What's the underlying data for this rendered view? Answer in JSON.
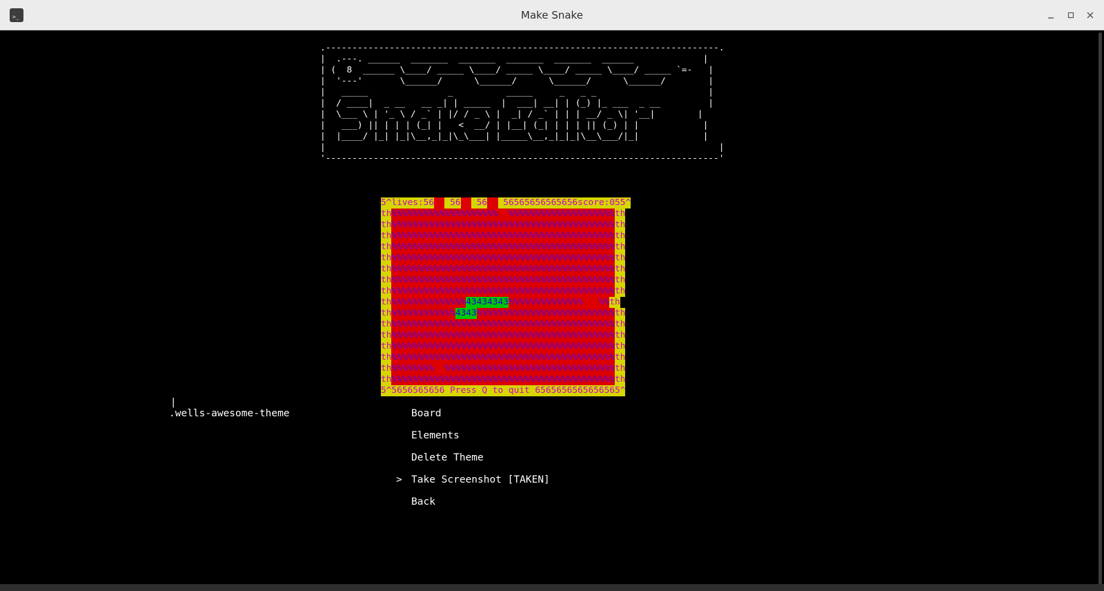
{
  "window": {
    "title": "Make Snake",
    "app_icon": "terminal-icon",
    "controls": [
      "minimize-icon",
      "maximize-icon",
      "close-icon"
    ]
  },
  "banner": {
    "ascii_art": ".--------------------------------------------------------------------------.\n|  .---. ______  _______  _______  _______  _______  ______             |\n| (  8  ______ \\____/ _____ \\____/ _____ \\____/ _____ \\____/ _____ `=-   |\n|  '---'       \\______/      \\______/      \\______/      \\______/        |\n|   _____               _          _____     _   _ _                     |\n|  / ____|  _ __   __ _| | _____  |  ___| __| | (_) |_ ___  _ __         |\n|  \\___ \\ | '_ \\ / _` | |/ / _ \\ |  _| / _` | | | __/ _ \\| '__|        |\n|   ___) || | | | (_| |   <  __/ | |__| (_| | | | || (_) | |            |\n|  |____/ |_| |_|\\__,_|_|\\_\\___| |_____\\__,_|_|_|\\__\\___/|_|            |\n|                                                                          |\n'--------------------------------------------------------------------------'"
  },
  "board": {
    "colors": {
      "border_bg": "#d6d600",
      "border_fg": "#cc00cc",
      "field_bg": "#dd0000",
      "field_fg": "#5a00e0",
      "snake_bg": "#00c800",
      "snake_fg": "#1a00dd"
    },
    "rows": [
      [
        {
          "c": "y",
          "t": "5^lives:56"
        },
        {
          "c": "r",
          "t": "  "
        },
        {
          "c": "y",
          "t": " 56"
        },
        {
          "c": "r",
          "t": "  "
        },
        {
          "c": "y",
          "t": " 56"
        },
        {
          "c": "r",
          "t": "  "
        },
        {
          "c": "y",
          "t": " 56565656565656score:055^"
        }
      ],
      [
        {
          "c": "y",
          "t": "th"
        },
        {
          "c": "r",
          "t": "%%%%%%%%%%%%%%%%%%%%  %%%%%%%%%%%%%%%%%%%%"
        },
        {
          "c": "y",
          "t": "th"
        }
      ],
      [
        {
          "c": "y",
          "t": "th"
        },
        {
          "c": "r",
          "t": "%%%%%%%%%%%%%%%%%%%%%%%%%%%%%%%%%%%%%%%%%%"
        },
        {
          "c": "y",
          "t": "th"
        }
      ],
      [
        {
          "c": "y",
          "t": "th"
        },
        {
          "c": "r",
          "t": "%%%%%%%%%%%%%%%%%%%%%%%%%%%%%%%%%%%%%%%%%%"
        },
        {
          "c": "y",
          "t": "th"
        }
      ],
      [
        {
          "c": "y",
          "t": "th"
        },
        {
          "c": "r",
          "t": "%%%%%%%%%%%%%%%%%%%%%%%%%%%%%%%%%%%%%%%%%%"
        },
        {
          "c": "y",
          "t": "th"
        }
      ],
      [
        {
          "c": "y",
          "t": "th"
        },
        {
          "c": "r",
          "t": "%%%%%%%%%%%%%%%%%%%%%%%%%%%%%%%%%%%%%%%%%%"
        },
        {
          "c": "y",
          "t": "th"
        }
      ],
      [
        {
          "c": "y",
          "t": "th"
        },
        {
          "c": "r",
          "t": "%%%%%%%%%%%%%%%%%%%%%%%%%%%%%%%%%%%%%%%%%%"
        },
        {
          "c": "y",
          "t": "th"
        }
      ],
      [
        {
          "c": "y",
          "t": "th"
        },
        {
          "c": "r",
          "t": "%%%%%%%%%%%%%%%%%%%%%%%%%%%%%%%%%%%%%%%%%%"
        },
        {
          "c": "y",
          "t": "th"
        }
      ],
      [
        {
          "c": "y",
          "t": "th"
        },
        {
          "c": "r",
          "t": "%%%%%%%%%%%%%%%%%%%%%%%%%%%%%%%%%%%%%%%%%%"
        },
        {
          "c": "y",
          "t": "th"
        }
      ],
      [
        {
          "c": "y",
          "t": "th"
        },
        {
          "c": "r",
          "t": "%%%%%%%%%%%%%%"
        },
        {
          "c": "g",
          "t": "43434343"
        },
        {
          "c": "r",
          "t": "%%%%%%%%%%%%%%   %%"
        },
        {
          "c": "y",
          "t": "th"
        }
      ],
      [
        {
          "c": "y",
          "t": "th"
        },
        {
          "c": "r",
          "t": "%%%%%%%%%%%%"
        },
        {
          "c": "g",
          "t": "4343"
        },
        {
          "c": "r",
          "t": "%%%%%%%%%%%%%%%%%%%%%%%%%%"
        },
        {
          "c": "y",
          "t": "th"
        }
      ],
      [
        {
          "c": "y",
          "t": "th"
        },
        {
          "c": "r",
          "t": "%%%%%%%%%%%%%%%%%%%%%%%%%%%%%%%%%%%%%%%%%%"
        },
        {
          "c": "y",
          "t": "th"
        }
      ],
      [
        {
          "c": "y",
          "t": "th"
        },
        {
          "c": "r",
          "t": "%%%%%%%%%%%%%%%%%%%%%%%%%%%%%%%%%%%%%%%%%%"
        },
        {
          "c": "y",
          "t": "th"
        }
      ],
      [
        {
          "c": "y",
          "t": "th"
        },
        {
          "c": "r",
          "t": "%%%%%%%%%%%%%%%%%%%%%%%%%%%%%%%%%%%%%%%%%%"
        },
        {
          "c": "y",
          "t": "th"
        }
      ],
      [
        {
          "c": "y",
          "t": "th"
        },
        {
          "c": "r",
          "t": "%%%%%%%%%%%%%%%%%%%%%%%%%%%%%%%%%%%%%%%%%%"
        },
        {
          "c": "y",
          "t": "th"
        }
      ],
      [
        {
          "c": "y",
          "t": "th"
        },
        {
          "c": "r",
          "t": "%%%%%%%%  %%%%%%%%%%%%%%%%%%%%%%%%%%%%%%%%"
        },
        {
          "c": "y",
          "t": "th"
        }
      ],
      [
        {
          "c": "y",
          "t": "th"
        },
        {
          "c": "r",
          "t": "%%%%%%%%%%%%%%%%%%%%%%%%%%%%%%%%%%%%%%%%%%"
        },
        {
          "c": "y",
          "t": "th"
        }
      ],
      [
        {
          "c": "y",
          "t": "5^5656565656 Press Q to quit 6565656565656565^"
        }
      ]
    ]
  },
  "theme": {
    "cursor": "|",
    "name": ".wells-awesome-theme"
  },
  "menu": {
    "selector": ">",
    "selected_index": 3,
    "items": [
      {
        "label": "Board"
      },
      {
        "label": "Elements"
      },
      {
        "label": "Delete Theme"
      },
      {
        "label": "Take Screenshot [TAKEN]"
      },
      {
        "label": "Back"
      }
    ]
  }
}
